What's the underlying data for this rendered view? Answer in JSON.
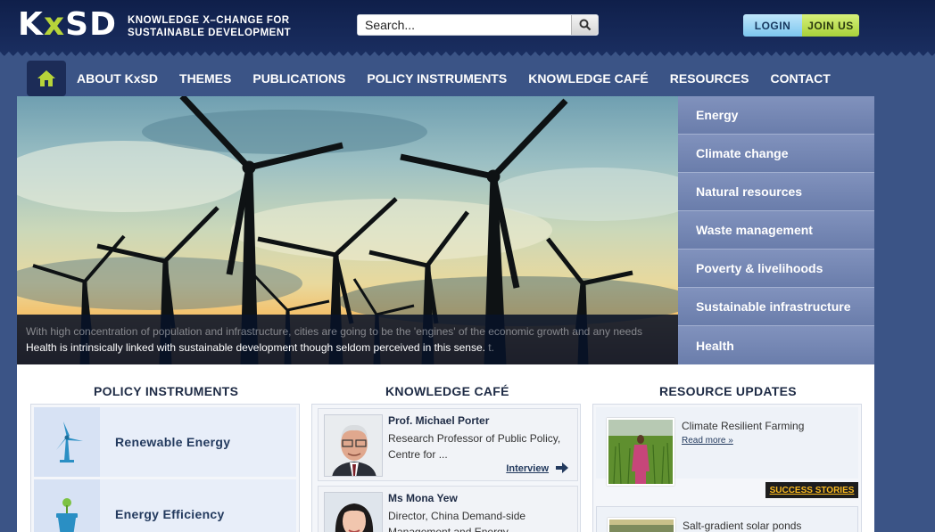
{
  "header": {
    "logo_text_a": "K",
    "logo_text_x": "x",
    "logo_text_b": "SD",
    "tagline_line1": "KNOWLEDGE X–CHANGE FOR",
    "tagline_line2": "SUSTAINABLE DEVELOPMENT",
    "search_placeholder": "Search...",
    "login_label": "LOGIN",
    "join_label": "JOIN US"
  },
  "nav": {
    "items": [
      "ABOUT KxSD",
      "THEMES",
      "PUBLICATIONS",
      "POLICY INSTRUMENTS",
      "KNOWLEDGE CAFÉ",
      "RESOURCES",
      "CONTACT"
    ]
  },
  "hero": {
    "caption_line1": "With high concentration of population and infrastructure, cities are going to be the 'engines' of the economic growth and any needs",
    "caption_line2": "Health is intrinsically linked with sustainable development though seldom perceived in this sense.",
    "caption_line2_tail": "t."
  },
  "themes": [
    "Energy",
    "Climate change",
    "Natural resources",
    "Waste management",
    "Poverty & livelihoods",
    "Sustainable infrastructure",
    "Health"
  ],
  "columns": {
    "policy_title": "POLICY INSTRUMENTS",
    "cafe_title": "KNOWLEDGE CAFÉ",
    "resource_title": "RESOURCE UPDATES"
  },
  "policy": [
    {
      "label": "Renewable Energy"
    },
    {
      "label": "Energy Efficiency"
    }
  ],
  "cafe": [
    {
      "name": "Prof. Michael Porter",
      "desc": "Research Professor of Public Policy, Centre for ...",
      "link": "Interview"
    },
    {
      "name": "Ms Mona Yew",
      "desc": "Director, China Demand-side Management and Energy"
    }
  ],
  "resources": [
    {
      "title": "Climate Resilient Farming",
      "more": "Read more »",
      "badge": "SUCCESS STORIES"
    },
    {
      "title": "Salt-gradient solar ponds"
    }
  ],
  "colors": {
    "accent_green": "#b7d43a",
    "nav_bg": "#3b5486",
    "header_bg": "#0f1f4a"
  }
}
